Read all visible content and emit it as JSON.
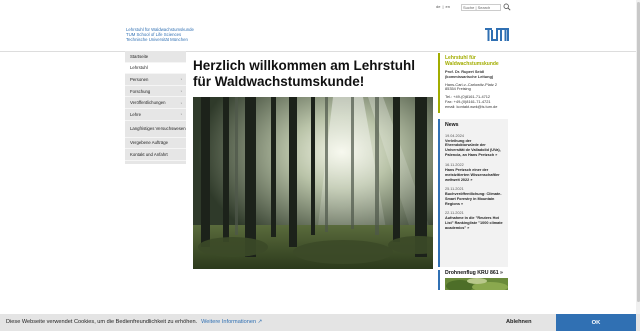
{
  "top": {
    "lang_de": "de",
    "lang_sep": "|",
    "lang_en": "en",
    "search_placeholder": "Suche | Search"
  },
  "header": {
    "line1": "Lehrstuhl für Waldwachstumskunde",
    "line2": "TUM School of Life Sciences",
    "line3": "Technische Universität München",
    "logo_text": "TUM",
    "logo_color": "#3070b3"
  },
  "sidebar": {
    "items": [
      {
        "label": "Startseite",
        "arrow": ""
      },
      {
        "label": "Lehrstuhl",
        "arrow": ""
      },
      {
        "label": "Personen",
        "arrow": "›"
      },
      {
        "label": "Forschung",
        "arrow": "›"
      },
      {
        "label": "Veröffentlichungen",
        "arrow": "›"
      },
      {
        "label": "Lehre",
        "arrow": "›"
      },
      {
        "label": "Langfristiges Versuchswesen",
        "arrow": ""
      },
      {
        "label": "Vergebene Aufträge",
        "arrow": ""
      },
      {
        "label": "Kontakt und Anfahrt",
        "arrow": ""
      }
    ]
  },
  "main": {
    "headline": "Herzlich willkommen am Lehrstuhl für Waldwachstumskunde!"
  },
  "contact": {
    "title": "Lehrstuhl für Waldwachstumskunde",
    "name": "Prof. Dr. Rupert Seidl",
    "role": "(kommissarische Leitung)",
    "street": "Hans-Carl-v.-Carlowitz-Platz 2",
    "city": "85354 Freising",
    "tel": "Tel.: +49-(0)8161-71-4712",
    "fax": "Fax: +49-(0)8161-71-4721",
    "email": "email: kontakt.wwk@ls.tum.de"
  },
  "news": {
    "title": "News",
    "items": [
      {
        "date": "19.04.2024",
        "text": "Verleihung der Ehrendoktorwürde der Universität de Valladolid (UVa), Palencia, an Hans Pretzsch »"
      },
      {
        "date": "16.11.2022",
        "text": "Hans Pretzsch einer der meistzitierten Wissenschaftler weltweit 2022 »"
      },
      {
        "date": "25.11.2021",
        "text": "Buchveröffentlichung: Climate-Smart Forestry in Mountain Regions »"
      },
      {
        "date": "22.11.2021",
        "text": "Aufnahme in die \"Reuters Hot List\" Rankingliste \"1000 climate academics\" »"
      }
    ]
  },
  "drohnen": {
    "title": "Drohnenflug KRU 861 »"
  },
  "cookie": {
    "text": "Diese Webseite verwendet Cookies, um die Bedienfreundlichkeit zu erhöhen.",
    "link": "Weitere Informationen ↗",
    "decline": "Ablehnen",
    "ok": "OK"
  }
}
